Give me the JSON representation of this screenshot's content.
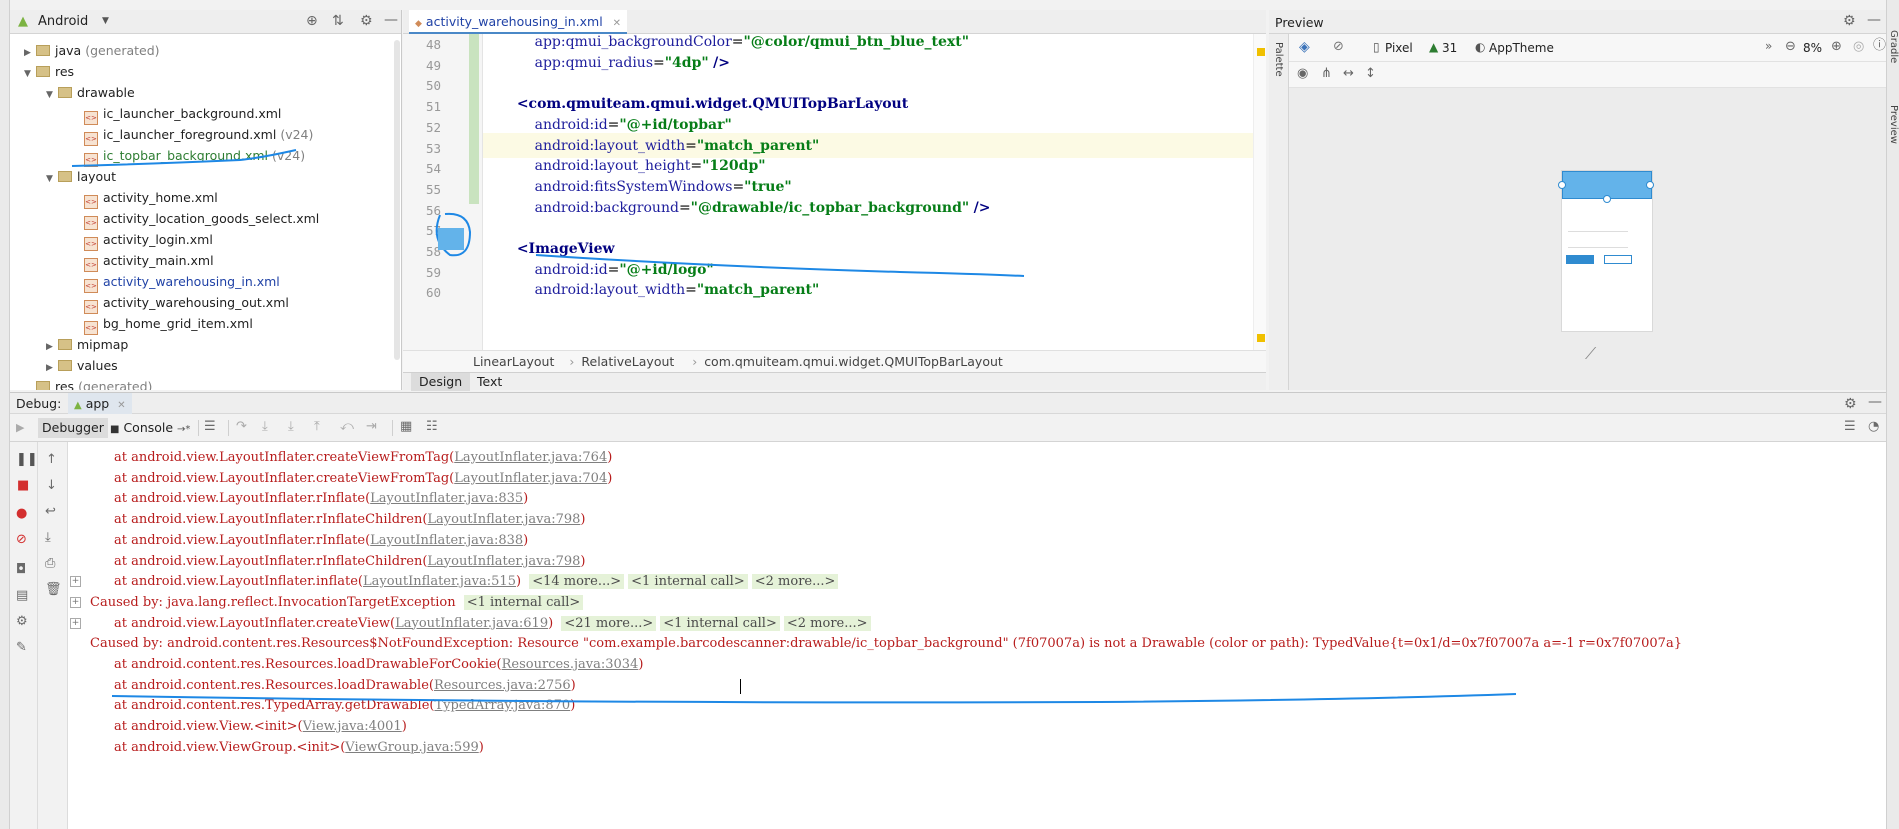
{
  "project": {
    "view_mode": "Android",
    "tree": [
      {
        "label": "java",
        "suffix": "(generated)",
        "level": 1,
        "arrow": "right",
        "kind": "folder"
      },
      {
        "label": "res",
        "suffix": "",
        "level": 1,
        "arrow": "down",
        "kind": "folder"
      },
      {
        "label": "drawable",
        "suffix": "",
        "level": 2,
        "arrow": "down",
        "kind": "folder"
      },
      {
        "label": "ic_launcher_background.xml",
        "suffix": "",
        "level": 3,
        "arrow": "",
        "kind": "xml"
      },
      {
        "label": "ic_launcher_foreground.xml",
        "suffix": "(v24)",
        "level": 3,
        "arrow": "",
        "kind": "xml"
      },
      {
        "label": "ic_topbar_background.xml",
        "suffix": "(v24)",
        "level": 3,
        "arrow": "",
        "kind": "xml",
        "color": "green"
      },
      {
        "label": "layout",
        "suffix": "",
        "level": 2,
        "arrow": "down",
        "kind": "folder"
      },
      {
        "label": "activity_home.xml",
        "suffix": "",
        "level": 3,
        "arrow": "",
        "kind": "xml"
      },
      {
        "label": "activity_location_goods_select.xml",
        "suffix": "",
        "level": 3,
        "arrow": "",
        "kind": "xml"
      },
      {
        "label": "activity_login.xml",
        "suffix": "",
        "level": 3,
        "arrow": "",
        "kind": "xml"
      },
      {
        "label": "activity_main.xml",
        "suffix": "",
        "level": 3,
        "arrow": "",
        "kind": "xml"
      },
      {
        "label": "activity_warehousing_in.xml",
        "suffix": "",
        "level": 3,
        "arrow": "",
        "kind": "xml",
        "color": "blue"
      },
      {
        "label": "activity_warehousing_out.xml",
        "suffix": "",
        "level": 3,
        "arrow": "",
        "kind": "xml"
      },
      {
        "label": "bg_home_grid_item.xml",
        "suffix": "",
        "level": 3,
        "arrow": "",
        "kind": "xml"
      },
      {
        "label": "mipmap",
        "suffix": "",
        "level": 2,
        "arrow": "right",
        "kind": "folder"
      },
      {
        "label": "values",
        "suffix": "",
        "level": 2,
        "arrow": "right",
        "kind": "folder"
      },
      {
        "label": "res",
        "suffix": "(generated)",
        "level": 1,
        "arrow": "",
        "kind": "folder"
      }
    ]
  },
  "editor": {
    "tab_label": "activity_warehousing_in.xml",
    "lines": [
      {
        "num": "48",
        "text": "        app:qmui_backgroundColor=\"@color/qmui_btn_blue_text\""
      },
      {
        "num": "49",
        "text": "        app:qmui_radius=\"4dp\" />"
      },
      {
        "num": "50",
        "text": ""
      },
      {
        "num": "51",
        "text": "    <com.qmuiteam.qmui.widget.QMUITopBarLayout"
      },
      {
        "num": "52",
        "text": "        android:id=\"@+id/topbar\""
      },
      {
        "num": "53",
        "text": "        android:layout_width=\"match_parent\""
      },
      {
        "num": "54",
        "text": "        android:layout_height=\"120dp\""
      },
      {
        "num": "55",
        "text": "        android:fitsSystemWindows=\"true\""
      },
      {
        "num": "56",
        "text": "        android:background=\"@drawable/ic_topbar_background\" />"
      },
      {
        "num": "57",
        "text": ""
      },
      {
        "num": "58",
        "text": "    <ImageView"
      },
      {
        "num": "59",
        "text": "        android:id=\"@+id/logo\""
      },
      {
        "num": "60",
        "text": "        android:layout_width=\"match_parent\""
      }
    ],
    "breadcrumb": [
      "LinearLayout",
      "RelativeLayout",
      "com.qmuiteam.qmui.widget.QMUITopBarLayout"
    ],
    "bottom_tabs": [
      "Design",
      "Text"
    ]
  },
  "preview": {
    "title": "Preview",
    "device": "Pixel",
    "api": "31",
    "theme": "AppTheme",
    "zoom": "8%",
    "palette_label": "Palette",
    "gradle_label": "Gradle",
    "preview_side_label": "Preview"
  },
  "debug": {
    "title": "Debug:",
    "config": "app",
    "tabs": [
      "Debugger",
      "Console"
    ],
    "console_lines": [
      {
        "indent": 1,
        "prefix": "at android.view.LayoutInflater.createViewFromTag(",
        "link": "LayoutInflater.java:764",
        "suffix": ")",
        "extra": []
      },
      {
        "indent": 1,
        "prefix": "at android.view.LayoutInflater.createViewFromTag(",
        "link": "LayoutInflater.java:704",
        "suffix": ")",
        "extra": []
      },
      {
        "indent": 1,
        "prefix": "at android.view.LayoutInflater.rInflate(",
        "link": "LayoutInflater.java:835",
        "suffix": ")",
        "extra": []
      },
      {
        "indent": 1,
        "prefix": "at android.view.LayoutInflater.rInflateChildren(",
        "link": "LayoutInflater.java:798",
        "suffix": ")",
        "extra": []
      },
      {
        "indent": 1,
        "prefix": "at android.view.LayoutInflater.rInflate(",
        "link": "LayoutInflater.java:838",
        "suffix": ")",
        "extra": []
      },
      {
        "indent": 1,
        "prefix": "at android.view.LayoutInflater.rInflateChildren(",
        "link": "LayoutInflater.java:798",
        "suffix": ")",
        "extra": []
      },
      {
        "indent": 1,
        "prefix": "at android.view.LayoutInflater.inflate(",
        "link": "LayoutInflater.java:515",
        "suffix": ") ",
        "extra": [
          "<14 more...>",
          "<1 internal call>",
          "<2 more...>"
        ],
        "plus": true
      },
      {
        "indent": 0,
        "prefix": "Caused by: java.lang.reflect.InvocationTargetException ",
        "link": "",
        "suffix": "",
        "extra": [
          "<1 internal call>"
        ],
        "plus": true
      },
      {
        "indent": 1,
        "prefix": "at android.view.LayoutInflater.createView(",
        "link": "LayoutInflater.java:619",
        "suffix": ") ",
        "extra": [
          "<21 more...>",
          "<1 internal call>",
          "<2 more...>"
        ],
        "plus": true
      },
      {
        "indent": 0,
        "prefix": "Caused by: android.content.res.Resources$NotFoundException: Resource \"com.example.barcodescanner:drawable/ic_topbar_background\" (7f07007a) is not a Drawable (color or path): TypedValue{t=0x1/d=0x7f07007a a=-1 r=0x7f07007a}",
        "link": "",
        "suffix": "",
        "extra": []
      },
      {
        "indent": 1,
        "prefix": "at android.content.res.Resources.loadDrawableForCookie(",
        "link": "Resources.java:3034",
        "suffix": ")",
        "extra": []
      },
      {
        "indent": 1,
        "prefix": "at android.content.res.Resources.loadDrawable(",
        "link": "Resources.java:2756",
        "suffix": ")",
        "extra": []
      },
      {
        "indent": 1,
        "prefix": "at android.content.res.TypedArray.getDrawable(",
        "link": "TypedArray.java:870",
        "suffix": ")",
        "extra": []
      },
      {
        "indent": 1,
        "prefix": "at android.view.View.<init>(",
        "link": "View.java:4001",
        "suffix": ")",
        "extra": []
      },
      {
        "indent": 1,
        "prefix": "at android.view.ViewGroup.<init>(",
        "link": "ViewGroup.java:599",
        "suffix": ")",
        "extra": []
      }
    ]
  },
  "colors": {
    "accent": "#4a88c7",
    "error_text": "#b71c1c",
    "annotation": "#1e88e5"
  }
}
